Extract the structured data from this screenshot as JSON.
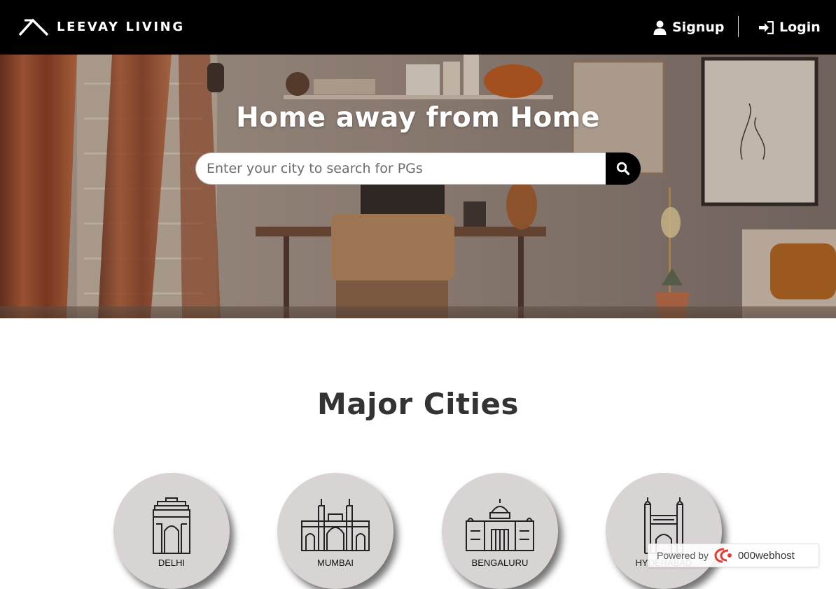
{
  "navbar": {
    "brand": "LEEVAY LIVING",
    "signup_label": "Signup",
    "login_label": "Login"
  },
  "hero": {
    "title": "Home away from Home",
    "search_placeholder": "Enter your city to search for PGs"
  },
  "cities": {
    "title": "Major Cities",
    "items": [
      {
        "name": "DELHI"
      },
      {
        "name": "MUMBAI"
      },
      {
        "name": "BENGALURU"
      },
      {
        "name": "HYDERABAD"
      }
    ]
  },
  "footer_badge": {
    "powered_by": "Powered by",
    "host_name": "000webhost"
  },
  "colors": {
    "navbar_bg": "#000000",
    "city_circle": "#d9d4d4",
    "heading_text": "#333333"
  },
  "icons": {
    "brand": "house-roof-icon",
    "signup": "user-icon",
    "login": "sign-in-icon",
    "search": "search-icon"
  }
}
